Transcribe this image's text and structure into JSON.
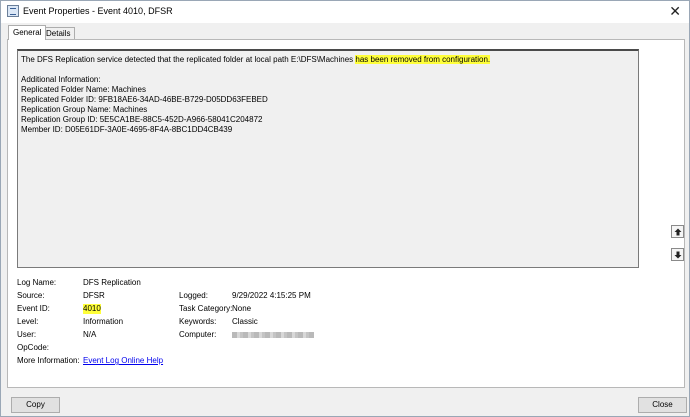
{
  "window": {
    "title": "Event Properties - Event 4010, DFSR",
    "close_glyph": "✕"
  },
  "tabs": [
    {
      "label": "General",
      "active": true
    },
    {
      "label": "Details",
      "active": false
    }
  ],
  "description": {
    "line1_pre": "The DFS Replication service detected that the replicated folder at local path E:\\DFS\\Machines ",
    "line1_highlight": "has been removed from configuration.",
    "additional_header": "Additional Information:",
    "lines": [
      "Replicated Folder Name: Machines",
      "Replicated Folder ID: 9FB18AE6-34AD-46BE-B729-D05DD63FEBED",
      "Replication Group Name: Machines",
      "Replication Group ID: 5E5CA1BE-88C5-452D-A966-58041C204872",
      "Member ID: D05E61DF-3A0E-4695-8F4A-8BC1DD4CB439"
    ]
  },
  "fields": {
    "log_name_label": "Log Name:",
    "log_name_value": "DFS Replication",
    "source_label": "Source:",
    "source_value": "DFSR",
    "logged_label": "Logged:",
    "logged_value": "9/29/2022 4:15:25 PM",
    "event_id_label": "Event ID:",
    "event_id_value": "4010",
    "task_category_label": "Task Category:",
    "task_category_value": "None",
    "level_label": "Level:",
    "level_value": "Information",
    "keywords_label": "Keywords:",
    "keywords_value": "Classic",
    "user_label": "User:",
    "user_value": "N/A",
    "computer_label": "Computer:",
    "opcode_label": "OpCode:",
    "more_info_label": "More Information:",
    "more_info_link": "Event Log Online Help"
  },
  "buttons": {
    "copy": "Copy",
    "close": "Close"
  },
  "colors": {
    "highlight": "#ffff3a",
    "link": "#0000ee"
  },
  "icons": {
    "scroll_up": "arrow-up-icon",
    "scroll_down": "arrow-down-icon",
    "app": "event-viewer-icon"
  }
}
